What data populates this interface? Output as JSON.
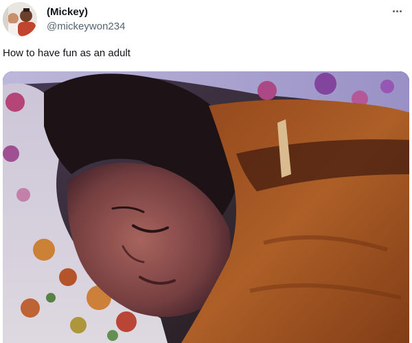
{
  "author": {
    "display_name": "(Mickey)",
    "handle": "@mickeywon234",
    "avatar": "profile-photo-two-people"
  },
  "more_menu": {
    "icon": "more-horizontal-icon"
  },
  "tweet": {
    "text": "How to have fun as an adult"
  },
  "media": {
    "kind": "video-still",
    "description_icon": "sleeping-person-photo"
  },
  "colors": {
    "text_primary": "#0f1419",
    "text_secondary": "#536471",
    "background": "#ffffff"
  }
}
